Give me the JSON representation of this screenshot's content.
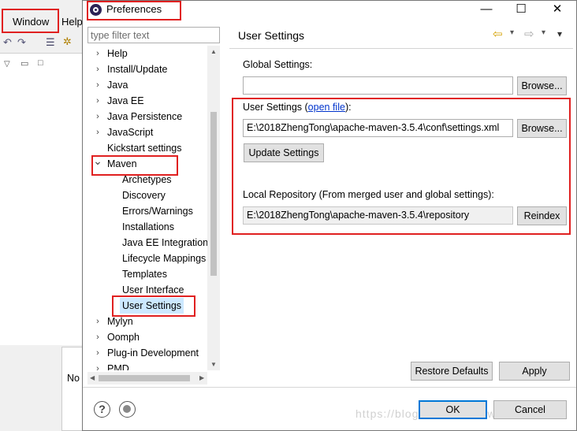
{
  "background": {
    "menu": [
      "Window",
      "Help"
    ],
    "status_text": "No"
  },
  "dialog": {
    "title": "Preferences",
    "controls": {
      "minimize": "—",
      "maximize": "☐",
      "close": "✕"
    }
  },
  "filter": {
    "placeholder": "type filter text"
  },
  "tree": {
    "items": [
      {
        "label": "Help",
        "level": 0,
        "expander": "›"
      },
      {
        "label": "Install/Update",
        "level": 0,
        "expander": "›"
      },
      {
        "label": "Java",
        "level": 0,
        "expander": "›"
      },
      {
        "label": "Java EE",
        "level": 0,
        "expander": "›"
      },
      {
        "label": "Java Persistence",
        "level": 0,
        "expander": "›"
      },
      {
        "label": "JavaScript",
        "level": 0,
        "expander": "›"
      },
      {
        "label": "Kickstart settings",
        "level": 0,
        "expander": ""
      },
      {
        "label": "Maven",
        "level": 0,
        "expander": "⌄"
      },
      {
        "label": "Archetypes",
        "level": 1,
        "expander": ""
      },
      {
        "label": "Discovery",
        "level": 1,
        "expander": ""
      },
      {
        "label": "Errors/Warnings",
        "level": 1,
        "expander": ""
      },
      {
        "label": "Installations",
        "level": 1,
        "expander": ""
      },
      {
        "label": "Java EE Integration",
        "level": 1,
        "expander": ""
      },
      {
        "label": "Lifecycle Mappings",
        "level": 1,
        "expander": ""
      },
      {
        "label": "Templates",
        "level": 1,
        "expander": ""
      },
      {
        "label": "User Interface",
        "level": 1,
        "expander": ""
      },
      {
        "label": "User Settings",
        "level": 1,
        "expander": "",
        "selected": true
      },
      {
        "label": "Mylyn",
        "level": 0,
        "expander": "›"
      },
      {
        "label": "Oomph",
        "level": 0,
        "expander": "›"
      },
      {
        "label": "Plug-in Development",
        "level": 0,
        "expander": "›"
      },
      {
        "label": "PMD",
        "level": 0,
        "expander": "›"
      }
    ]
  },
  "page": {
    "title": "User Settings",
    "nav": {
      "back": "⇦",
      "back_menu": "▾",
      "forward": "⇨",
      "forward_menu": "▾",
      "view_menu": "▾"
    },
    "global_settings_label": "Global Settings:",
    "global_settings_value": "",
    "browse_label": "Browse...",
    "user_settings_label": "User Settings (",
    "open_file_link": "open file",
    "user_settings_label_end": "):",
    "user_settings_value": "E:\\2018ZhengTong\\apache-maven-3.5.4\\conf\\settings.xml",
    "update_settings_label": "Update Settings",
    "local_repo_label": "Local Repository (From merged user and global settings):",
    "local_repo_value": "E:\\2018ZhengTong\\apache-maven-3.5.4\\repository",
    "reindex_label": "Reindex",
    "restore_defaults_label": "Restore Defaults",
    "apply_label": "Apply"
  },
  "footer": {
    "help_icon": "?",
    "ok_label": "OK",
    "cancel_label": "Cancel",
    "watermark": "https://blog.csdn.net/lvlw"
  },
  "colors": {
    "annotation": "#e02020",
    "selection": "#cce8ff",
    "link": "#0033cc",
    "primary_border": "#0078d7"
  }
}
